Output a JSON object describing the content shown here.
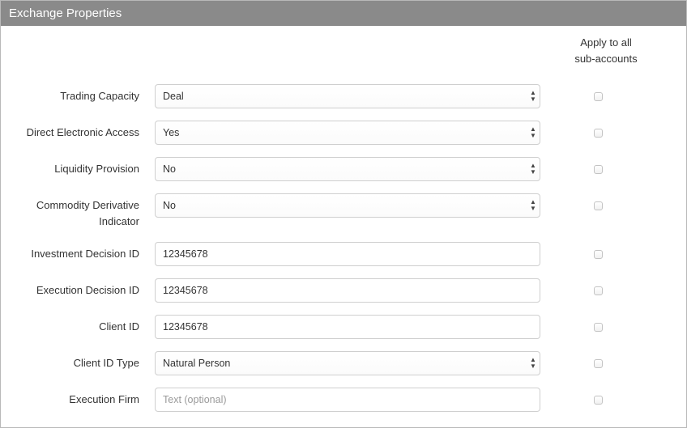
{
  "panel": {
    "title": "Exchange Properties",
    "apply_header_line1": "Apply to all",
    "apply_header_line2": "sub-accounts"
  },
  "fields": {
    "trading_capacity": {
      "label": "Trading Capacity",
      "value": "Deal",
      "apply_checked": false
    },
    "direct_electronic_access": {
      "label": "Direct Electronic Access",
      "value": "Yes",
      "apply_checked": false
    },
    "liquidity_provision": {
      "label": "Liquidity Provision",
      "value": "No",
      "apply_checked": false
    },
    "commodity_derivative_indicator": {
      "label_line1": "Commodity Derivative",
      "label_line2": "Indicator",
      "value": "No",
      "apply_checked": false
    },
    "investment_decision_id": {
      "label": "Investment Decision ID",
      "value": "12345678",
      "apply_checked": false
    },
    "execution_decision_id": {
      "label": "Execution Decision ID",
      "value": "12345678",
      "apply_checked": false
    },
    "client_id": {
      "label": "Client ID",
      "value": "12345678",
      "apply_checked": false
    },
    "client_id_type": {
      "label": "Client ID Type",
      "value": "Natural Person",
      "apply_checked": false
    },
    "execution_firm": {
      "label": "Execution Firm",
      "value": "",
      "placeholder": "Text (optional)",
      "apply_checked": false
    }
  },
  "icons": {
    "select_arrows": "up-down-chevron-icon"
  }
}
